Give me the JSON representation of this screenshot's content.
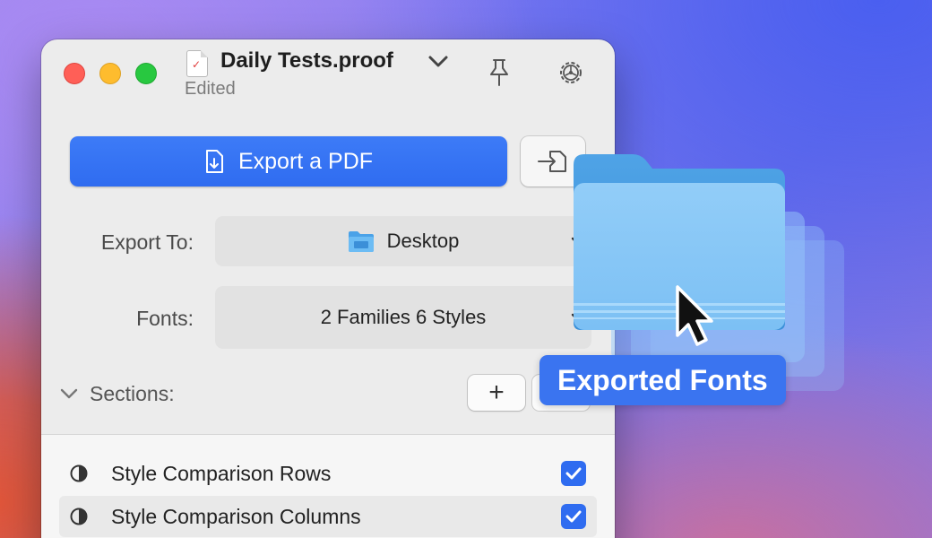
{
  "window": {
    "title": "Daily Tests.proof",
    "subtitle": "Edited",
    "doc_icon_glyph": "✓"
  },
  "toolbar": {
    "export_button_label": "Export a PDF"
  },
  "export_to": {
    "label": "Export To:",
    "value": "Desktop"
  },
  "fonts": {
    "label": "Fonts:",
    "value": "2 Families 6 Styles"
  },
  "sections": {
    "label": "Sections:",
    "add_label": "+",
    "items": [
      {
        "label": "Style Comparison Rows",
        "checked": true
      },
      {
        "label": "Style Comparison Columns",
        "checked": true
      }
    ]
  },
  "drag": {
    "label": "Exported Fonts"
  },
  "colors": {
    "accent": "#2f6cf0",
    "close": "#ff5f57",
    "minimize": "#febc2e",
    "zoom": "#28c840",
    "folder": "#84c4f5"
  }
}
